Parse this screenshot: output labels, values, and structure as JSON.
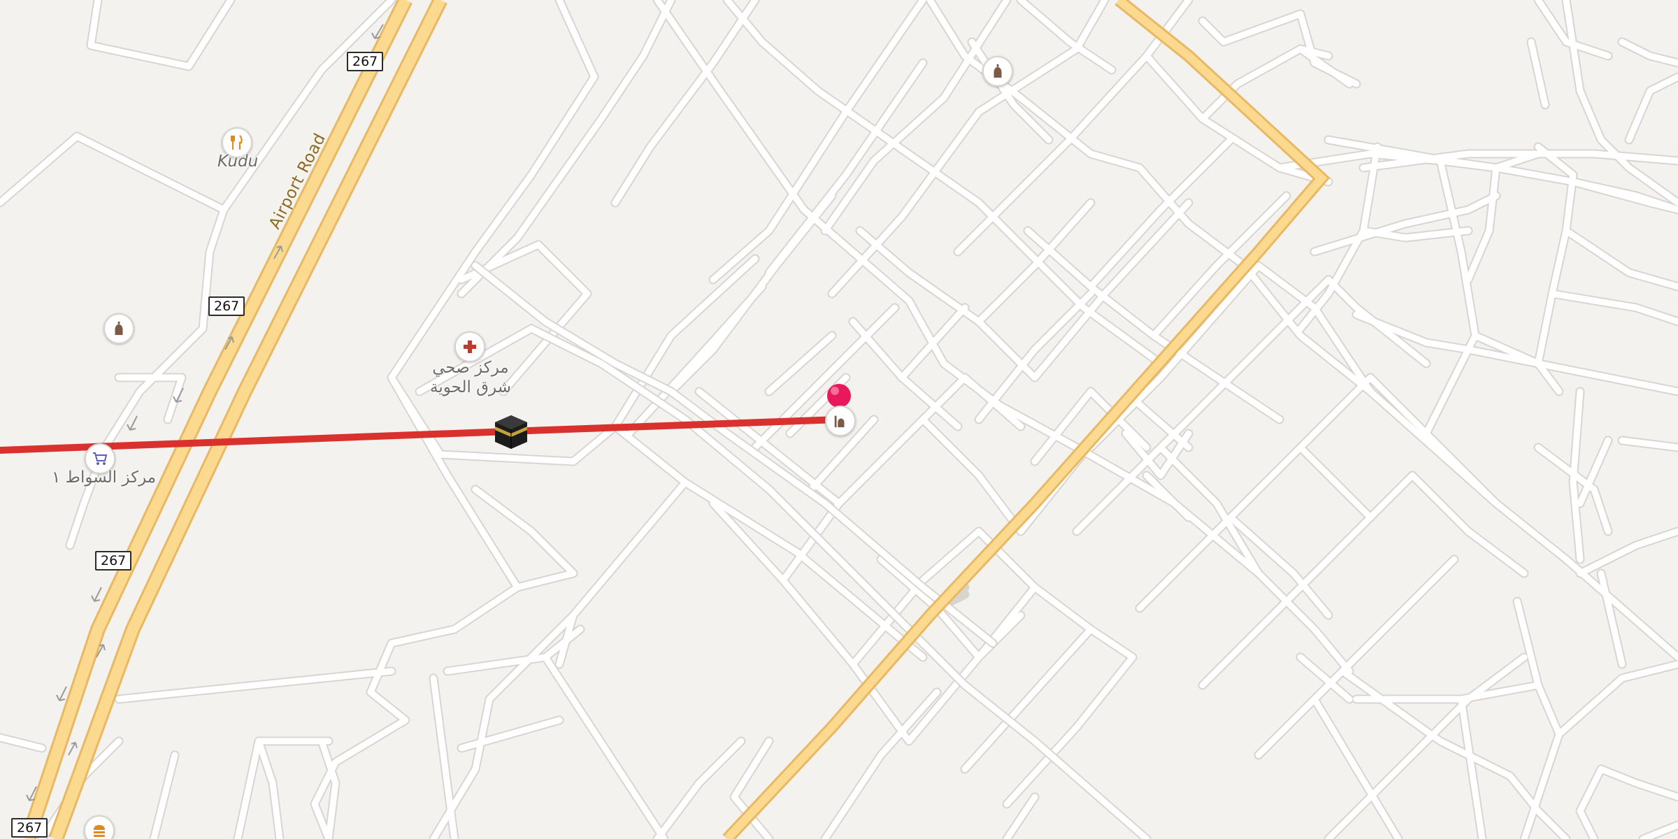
{
  "map": {
    "road_shields": [
      "267",
      "267",
      "267",
      "267"
    ],
    "road_label": "Airport Road",
    "pois": [
      {
        "name": "Kudu",
        "icon": "fork-knife-icon",
        "color": "#e08a1e"
      },
      {
        "name": "مركز صحي\nشرق الحوية",
        "icon": "medical-cross-icon",
        "color": "#c0392b"
      },
      {
        "name": "مركز السواط ١",
        "icon": "shopping-cart-icon",
        "color": "#5a5fbf"
      },
      {
        "name": "",
        "icon": "fast-food-icon",
        "color": "#e08a1e"
      },
      {
        "name": "",
        "icon": "mosque-icon",
        "color": "#7b5a46"
      },
      {
        "name": "",
        "icon": "mosque-icon",
        "color": "#7b5a46"
      },
      {
        "name": "",
        "icon": "mosque-icon",
        "color": "#7b5a46"
      },
      {
        "name": "",
        "icon": "kaaba-icon",
        "color": "#1a1a1a"
      }
    ],
    "route_color": "#d9312d",
    "pin_color": "#e8185c",
    "major_road_color": "#fbd98e",
    "background_color": "#f4f2ef"
  }
}
